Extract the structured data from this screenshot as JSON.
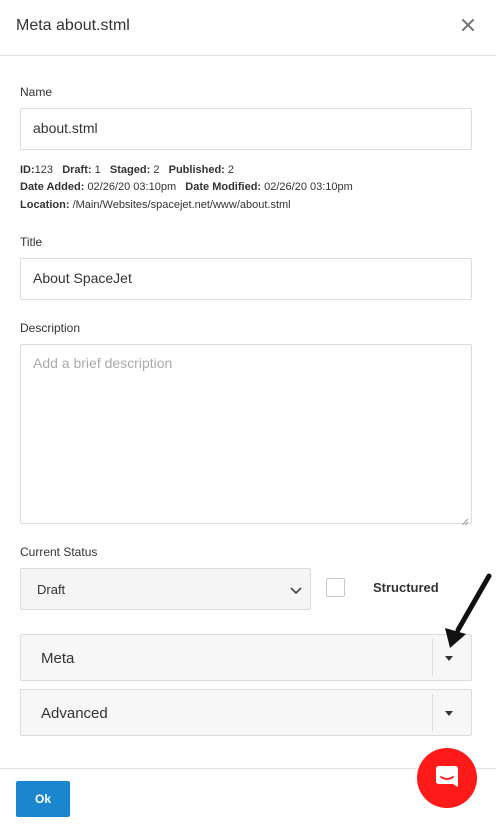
{
  "dialog": {
    "title": "Meta about.stml"
  },
  "name": {
    "label": "Name",
    "value": "about.stml"
  },
  "info": {
    "id_label": "ID:",
    "id_value": "123",
    "draft_label": "Draft:",
    "draft_value": "1",
    "staged_label": "Staged:",
    "staged_value": "2",
    "published_label": "Published:",
    "published_value": "2",
    "date_added_label": "Date Added:",
    "date_added_value": "02/26/20 03:10pm",
    "date_modified_label": "Date Modified:",
    "date_modified_value": "02/26/20 03:10pm",
    "location_label": "Location:",
    "location_value": "/Main/Websites/spacejet.net/www/about.stml"
  },
  "title_field": {
    "label": "Title",
    "value": "About SpaceJet"
  },
  "description": {
    "label": "Description",
    "placeholder": "Add a brief description"
  },
  "status": {
    "label": "Current Status",
    "selected": "Draft"
  },
  "structured": {
    "label": "Structured",
    "checked": false
  },
  "accordions": [
    {
      "label": "Meta"
    },
    {
      "label": "Advanced"
    }
  ],
  "footer": {
    "ok_label": "Ok"
  },
  "icons": {
    "close": "close-icon",
    "chat": "chat-icon",
    "chevron": "chevron-down-icon",
    "caret": "caret-down-icon"
  },
  "colors": {
    "primary": "#1a86d0",
    "chat": "#ff1a1a"
  }
}
